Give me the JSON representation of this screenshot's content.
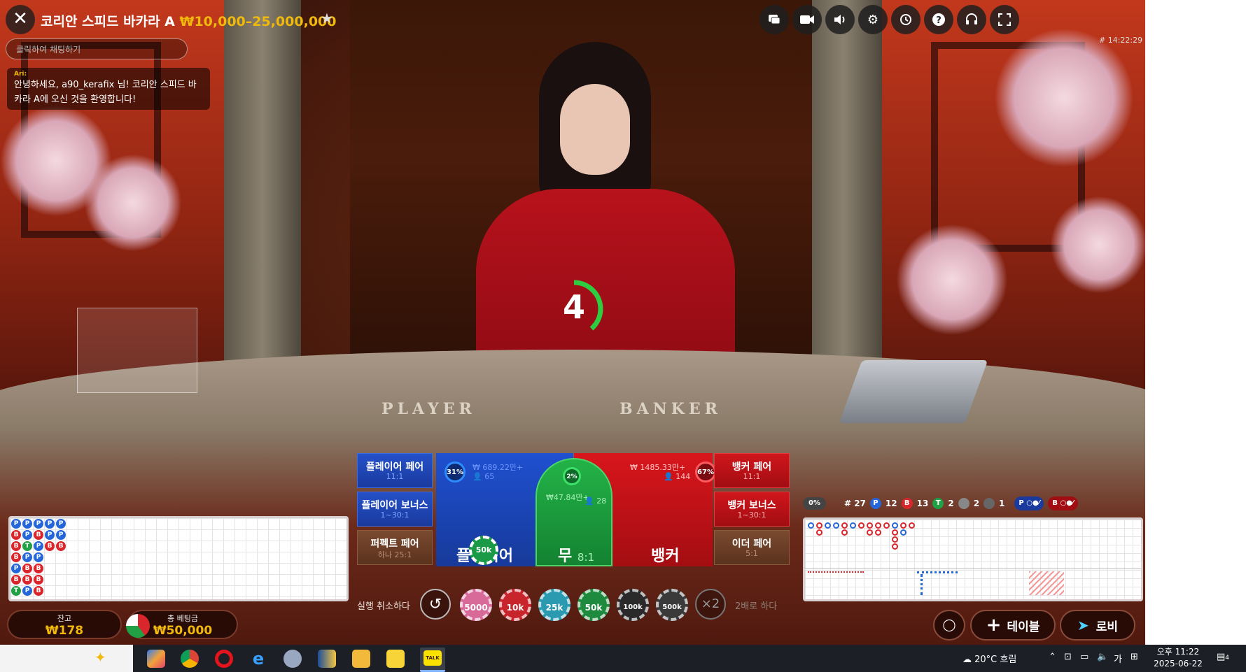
{
  "window": {
    "title": "코리안 스피드 바카라 A",
    "limits": "₩10,000–25,000,000",
    "game_id": "# 14:22:29"
  },
  "chat": {
    "placeholder": "클릭하여 채팅하기",
    "message_user": "Ari:",
    "message_line1": "안녕하세요, a90_kerafix 님! 코리안 스피드 바",
    "message_line2": "카라 A에 오신 것을 환영합니다!"
  },
  "timer": {
    "seconds": "4"
  },
  "table_print": {
    "player": "PLAYER",
    "banker": "BANKER"
  },
  "bets": {
    "player_pair": {
      "label": "플레이어 페어",
      "odds": "11:1"
    },
    "player_bonus": {
      "label": "플레이어 보너스",
      "odds": "1~30:1"
    },
    "perfect_pair": {
      "label": "퍼펙트 페어",
      "odds": "하나 25:1"
    },
    "banker_pair": {
      "label": "뱅커 페어",
      "odds": "11:1"
    },
    "banker_bonus": {
      "label": "뱅커 보너스",
      "odds": "1~30:1"
    },
    "either_pair": {
      "label": "이더 페어",
      "odds": "5:1"
    },
    "player": {
      "label": "플레이어",
      "pct": "31%",
      "amount": "₩ 689.22만+",
      "players": "65",
      "chip": "50k"
    },
    "tie": {
      "label": "무",
      "odds": "8:1",
      "pct": "2%",
      "amount": "₩47.84만+",
      "players": "28"
    },
    "banker": {
      "label": "뱅커",
      "pct": "67%",
      "amount": "₩ 1485.33만+",
      "players": "144"
    }
  },
  "controls": {
    "undo_label": "실행 취소하다",
    "undo_icon": "undo-icon",
    "double_label": "2배로 하다",
    "double_icon": "×2",
    "chips": [
      "5000",
      "10k",
      "25k",
      "50k",
      "100k",
      "500k"
    ]
  },
  "road_stats": {
    "percent": "0%",
    "total": "# 27",
    "player": "12",
    "banker": "13",
    "tie": "2",
    "player_pair": "2",
    "banker_pair": "1",
    "p_label": "P",
    "b_label": "B",
    "t_label": "T"
  },
  "bead_road": [
    [
      "P",
      "B",
      "B",
      "B",
      "P",
      "B",
      "T"
    ],
    [
      "P",
      "P",
      "T",
      "P",
      "B",
      "B",
      "P"
    ],
    [
      "P",
      "B",
      "P",
      "P",
      "B",
      "B",
      "B"
    ],
    [
      "P",
      "P",
      "B",
      "",
      "",
      "",
      ""
    ],
    [
      "P",
      "P",
      "B",
      "",
      "",
      "",
      ""
    ]
  ],
  "footer": {
    "balance_label": "잔고",
    "balance": "₩178",
    "total_bet_label": "총 베팅금",
    "total_bet": "₩50,000",
    "table_button": "테이블",
    "lobby_button": "로비"
  },
  "taskbar": {
    "weather": "20°C 흐림",
    "time": "오후 11:22",
    "date": "2025-06-22",
    "ime": "가",
    "notifications": "4"
  },
  "colors": {
    "player_blue": "#1f50d0",
    "banker_red": "#d8161c",
    "tie_green": "#23b347",
    "gold": "#f0b90b"
  }
}
